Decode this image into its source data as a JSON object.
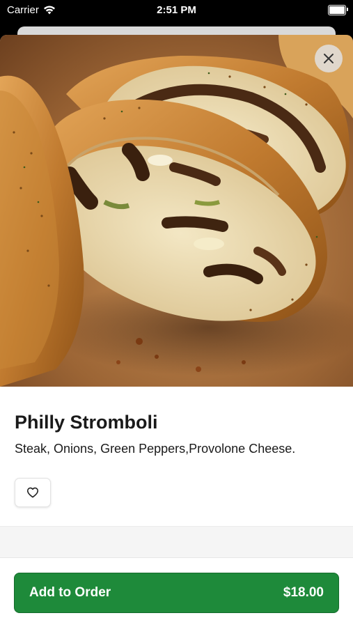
{
  "status_bar": {
    "carrier": "Carrier",
    "time": "2:51 PM",
    "wifi_icon": "wifi-icon",
    "battery_icon": "battery-icon"
  },
  "hero": {
    "image": "stromboli-photo",
    "close_icon": "close-icon"
  },
  "item": {
    "name": "Philly Stromboli",
    "description": "Steak, Onions, Green Peppers,Provolone Cheese.",
    "favorite_icon": "heart-icon"
  },
  "order": {
    "add_label": "Add to Order",
    "price": "$18.00"
  },
  "colors": {
    "accent": "#1e8a3a",
    "text": "#1a1a1a"
  }
}
